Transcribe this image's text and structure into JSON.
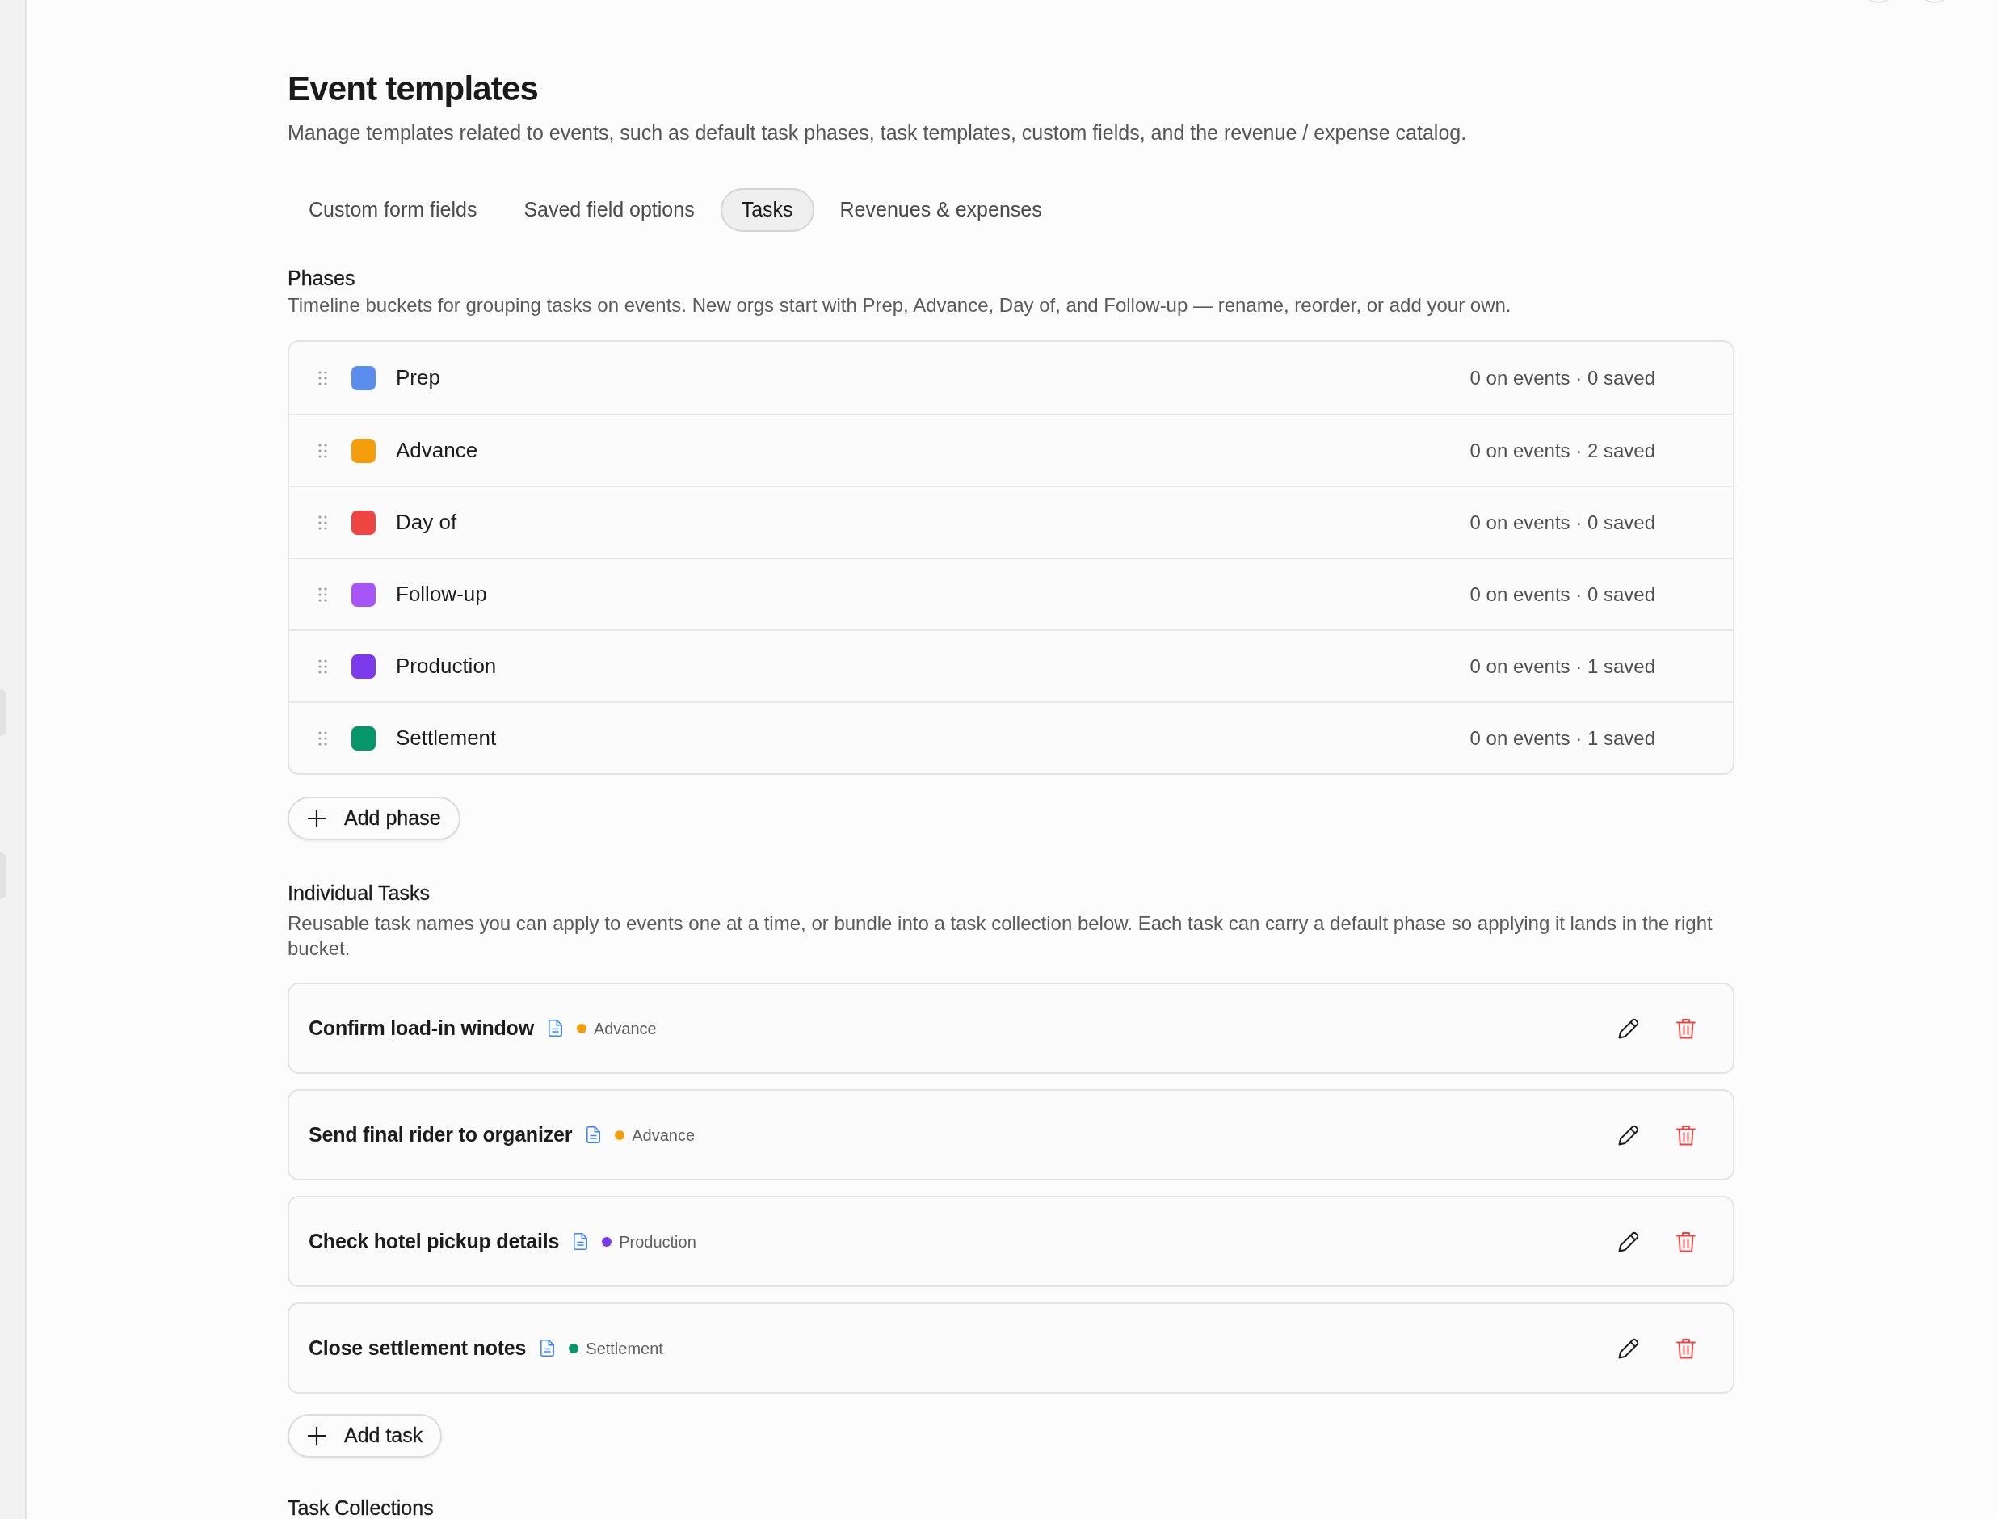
{
  "page": {
    "title": "Event templates",
    "description": "Manage templates related to events, such as default task phases, task templates, custom fields, and the revenue / expense catalog."
  },
  "tabs": [
    {
      "label": "Custom form fields",
      "selected": false
    },
    {
      "label": "Saved field options",
      "selected": false
    },
    {
      "label": "Tasks",
      "selected": true
    },
    {
      "label": "Revenues & expenses",
      "selected": false
    }
  ],
  "phases": {
    "title": "Phases",
    "description": "Timeline buckets for grouping tasks on events. New orgs start with Prep, Advance, Day of, and Follow-up — rename, reorder, or add your own.",
    "items": [
      {
        "name": "Prep",
        "color": "#5b8def",
        "usage": "0 on events · 0 saved"
      },
      {
        "name": "Advance",
        "color": "#f59e0b",
        "usage": "0 on events · 2 saved"
      },
      {
        "name": "Day of",
        "color": "#ef4444",
        "usage": "0 on events · 0 saved"
      },
      {
        "name": "Follow-up",
        "color": "#a855f7",
        "usage": "0 on events · 0 saved"
      },
      {
        "name": "Production",
        "color": "#7c3aed",
        "usage": "0 on events · 1 saved"
      },
      {
        "name": "Settlement",
        "color": "#059669",
        "usage": "0 on events · 1 saved"
      }
    ],
    "add_button": "Add phase"
  },
  "tasks": {
    "title": "Individual Tasks",
    "description": "Reusable task names you can apply to events one at a time, or bundle into a task collection below. Each task can carry a default phase so applying it lands in the right bucket.",
    "items": [
      {
        "name": "Confirm load-in window",
        "has_notes": true,
        "phase": "Advance",
        "color": "#f59e0b"
      },
      {
        "name": "Send final rider to organizer",
        "has_notes": true,
        "phase": "Advance",
        "color": "#f59e0b"
      },
      {
        "name": "Check hotel pickup details",
        "has_notes": true,
        "phase": "Production",
        "color": "#7c3aed"
      },
      {
        "name": "Close settlement notes",
        "has_notes": true,
        "phase": "Settlement",
        "color": "#059669"
      }
    ],
    "add_button": "Add task"
  },
  "collections": {
    "title": "Task Collections"
  }
}
